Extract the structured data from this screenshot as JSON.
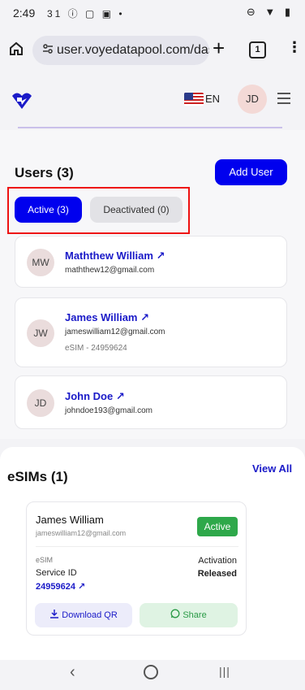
{
  "status_bar": {
    "time": "2:49",
    "left_icons": "31 ⓘ ▢ ▣ •",
    "right_icons": "⊖ ▼ ▮"
  },
  "browser": {
    "url": "user.voyedatapool.com/das",
    "tab_count": "1",
    "new_tab": "+",
    "menu": "⋮"
  },
  "header": {
    "language": "EN",
    "avatar_initials": "JD",
    "brand_color": "#0000ee"
  },
  "users": {
    "title": "Users (3)",
    "add_user_label": "Add User",
    "tabs": [
      {
        "label": "Active (3)",
        "selected": true
      },
      {
        "label": "Deactivated (0)",
        "selected": false
      }
    ],
    "list": [
      {
        "initials": "MW",
        "name": "Maththew William",
        "email": "maththew12@gmail.com",
        "esim": ""
      },
      {
        "initials": "JW",
        "name": "James William",
        "email": "jameswilliam12@gmail.com",
        "esim": "eSIM - 24959624"
      },
      {
        "initials": "JD",
        "name": "John Doe",
        "email": "johndoe193@gmail.com",
        "esim": ""
      }
    ],
    "link_arrow": "↗"
  },
  "esims": {
    "title": "eSIMs (1)",
    "view_all": "View All",
    "card": {
      "name": "James William",
      "email": "jameswilliam12@gmail.com",
      "status": "Active",
      "esim_label": "eSIM",
      "service_id_label": "Service ID",
      "service_id": "24959624",
      "activation_label": "Activation",
      "activation_value": "Released",
      "download_label": "Download QR",
      "share_label": "Share"
    }
  },
  "nav": {
    "back": "‹",
    "recent": "|||"
  }
}
